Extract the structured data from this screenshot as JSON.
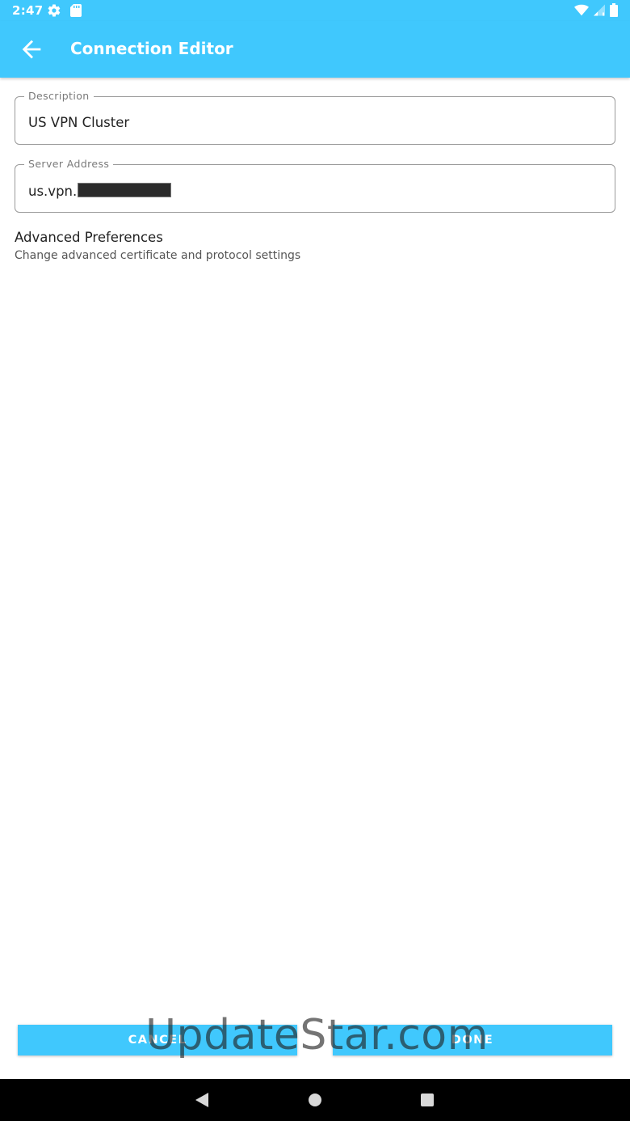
{
  "status_bar": {
    "time": "2:47"
  },
  "app_bar": {
    "title": "Connection Editor"
  },
  "description_field": {
    "label": "Description",
    "value": "US VPN Cluster"
  },
  "server_field": {
    "label": "Server Address",
    "value_prefix": "us.vpn."
  },
  "advanced_prefs": {
    "title": "Advanced Preferences",
    "subtitle": "Change advanced certificate and protocol settings"
  },
  "buttons": {
    "cancel": "CANCEL",
    "done": "DONE"
  },
  "watermark": "UpdateStar.com",
  "colors": {
    "accent": "#40c8fd"
  }
}
